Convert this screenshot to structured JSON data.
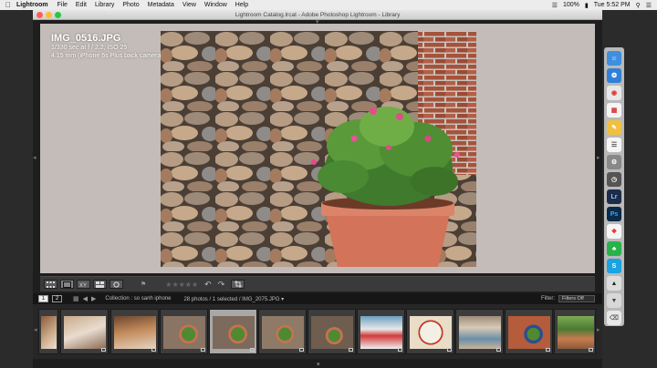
{
  "menubar": {
    "app_name": "Lightroom",
    "menus": [
      "File",
      "Edit",
      "Library",
      "Photo",
      "Metadata",
      "View",
      "Window",
      "Help"
    ],
    "battery": "100%",
    "clock": "Tue 5:52 PM"
  },
  "window": {
    "title": "Lightroom Catalog.lrcat - Adobe Photoshop Lightroom - Library"
  },
  "loupe": {
    "filename": "IMG_0516.JPG",
    "exposure": "1/330 sec at f / 2.2, ISO 25",
    "lens": "4.15 mm (iPhone 6s Plus back camera 4.15mm f/2.2)"
  },
  "toolbar": {
    "rating": "★★★★★",
    "rotate_left": "↶",
    "rotate_right": "↷"
  },
  "filmstrip": {
    "monitor_1": "1",
    "monitor_2": "2",
    "collection": "Collection : so sanh iphone",
    "count": "28 photos / 1 selected / IMG_2075.JPG ▾",
    "filter_label": "Filter:",
    "filter_value": "Filters Off",
    "selected_index": 3
  },
  "colors": {
    "loupe_bg": "#c3bcb9",
    "window_bg": "#1e1e1e"
  }
}
